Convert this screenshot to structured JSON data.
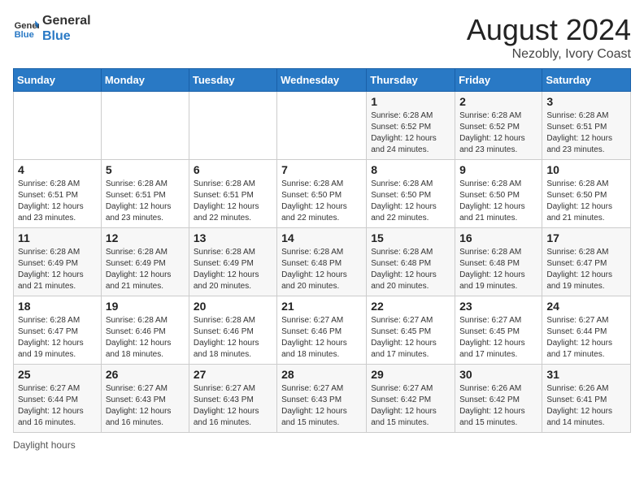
{
  "header": {
    "logo_line1": "General",
    "logo_line2": "Blue",
    "main_title": "August 2024",
    "subtitle": "Nezobly, Ivory Coast"
  },
  "days_of_week": [
    "Sunday",
    "Monday",
    "Tuesday",
    "Wednesday",
    "Thursday",
    "Friday",
    "Saturday"
  ],
  "weeks": [
    [
      {
        "day": "",
        "info": ""
      },
      {
        "day": "",
        "info": ""
      },
      {
        "day": "",
        "info": ""
      },
      {
        "day": "",
        "info": ""
      },
      {
        "day": "1",
        "info": "Sunrise: 6:28 AM\nSunset: 6:52 PM\nDaylight: 12 hours and 24 minutes."
      },
      {
        "day": "2",
        "info": "Sunrise: 6:28 AM\nSunset: 6:52 PM\nDaylight: 12 hours and 23 minutes."
      },
      {
        "day": "3",
        "info": "Sunrise: 6:28 AM\nSunset: 6:51 PM\nDaylight: 12 hours and 23 minutes."
      }
    ],
    [
      {
        "day": "4",
        "info": "Sunrise: 6:28 AM\nSunset: 6:51 PM\nDaylight: 12 hours and 23 minutes."
      },
      {
        "day": "5",
        "info": "Sunrise: 6:28 AM\nSunset: 6:51 PM\nDaylight: 12 hours and 23 minutes."
      },
      {
        "day": "6",
        "info": "Sunrise: 6:28 AM\nSunset: 6:51 PM\nDaylight: 12 hours and 22 minutes."
      },
      {
        "day": "7",
        "info": "Sunrise: 6:28 AM\nSunset: 6:50 PM\nDaylight: 12 hours and 22 minutes."
      },
      {
        "day": "8",
        "info": "Sunrise: 6:28 AM\nSunset: 6:50 PM\nDaylight: 12 hours and 22 minutes."
      },
      {
        "day": "9",
        "info": "Sunrise: 6:28 AM\nSunset: 6:50 PM\nDaylight: 12 hours and 21 minutes."
      },
      {
        "day": "10",
        "info": "Sunrise: 6:28 AM\nSunset: 6:50 PM\nDaylight: 12 hours and 21 minutes."
      }
    ],
    [
      {
        "day": "11",
        "info": "Sunrise: 6:28 AM\nSunset: 6:49 PM\nDaylight: 12 hours and 21 minutes."
      },
      {
        "day": "12",
        "info": "Sunrise: 6:28 AM\nSunset: 6:49 PM\nDaylight: 12 hours and 21 minutes."
      },
      {
        "day": "13",
        "info": "Sunrise: 6:28 AM\nSunset: 6:49 PM\nDaylight: 12 hours and 20 minutes."
      },
      {
        "day": "14",
        "info": "Sunrise: 6:28 AM\nSunset: 6:48 PM\nDaylight: 12 hours and 20 minutes."
      },
      {
        "day": "15",
        "info": "Sunrise: 6:28 AM\nSunset: 6:48 PM\nDaylight: 12 hours and 20 minutes."
      },
      {
        "day": "16",
        "info": "Sunrise: 6:28 AM\nSunset: 6:48 PM\nDaylight: 12 hours and 19 minutes."
      },
      {
        "day": "17",
        "info": "Sunrise: 6:28 AM\nSunset: 6:47 PM\nDaylight: 12 hours and 19 minutes."
      }
    ],
    [
      {
        "day": "18",
        "info": "Sunrise: 6:28 AM\nSunset: 6:47 PM\nDaylight: 12 hours and 19 minutes."
      },
      {
        "day": "19",
        "info": "Sunrise: 6:28 AM\nSunset: 6:46 PM\nDaylight: 12 hours and 18 minutes."
      },
      {
        "day": "20",
        "info": "Sunrise: 6:28 AM\nSunset: 6:46 PM\nDaylight: 12 hours and 18 minutes."
      },
      {
        "day": "21",
        "info": "Sunrise: 6:27 AM\nSunset: 6:46 PM\nDaylight: 12 hours and 18 minutes."
      },
      {
        "day": "22",
        "info": "Sunrise: 6:27 AM\nSunset: 6:45 PM\nDaylight: 12 hours and 17 minutes."
      },
      {
        "day": "23",
        "info": "Sunrise: 6:27 AM\nSunset: 6:45 PM\nDaylight: 12 hours and 17 minutes."
      },
      {
        "day": "24",
        "info": "Sunrise: 6:27 AM\nSunset: 6:44 PM\nDaylight: 12 hours and 17 minutes."
      }
    ],
    [
      {
        "day": "25",
        "info": "Sunrise: 6:27 AM\nSunset: 6:44 PM\nDaylight: 12 hours and 16 minutes."
      },
      {
        "day": "26",
        "info": "Sunrise: 6:27 AM\nSunset: 6:43 PM\nDaylight: 12 hours and 16 minutes."
      },
      {
        "day": "27",
        "info": "Sunrise: 6:27 AM\nSunset: 6:43 PM\nDaylight: 12 hours and 16 minutes."
      },
      {
        "day": "28",
        "info": "Sunrise: 6:27 AM\nSunset: 6:43 PM\nDaylight: 12 hours and 15 minutes."
      },
      {
        "day": "29",
        "info": "Sunrise: 6:27 AM\nSunset: 6:42 PM\nDaylight: 12 hours and 15 minutes."
      },
      {
        "day": "30",
        "info": "Sunrise: 6:26 AM\nSunset: 6:42 PM\nDaylight: 12 hours and 15 minutes."
      },
      {
        "day": "31",
        "info": "Sunrise: 6:26 AM\nSunset: 6:41 PM\nDaylight: 12 hours and 14 minutes."
      }
    ]
  ],
  "footer": {
    "daylight_label": "Daylight hours"
  }
}
